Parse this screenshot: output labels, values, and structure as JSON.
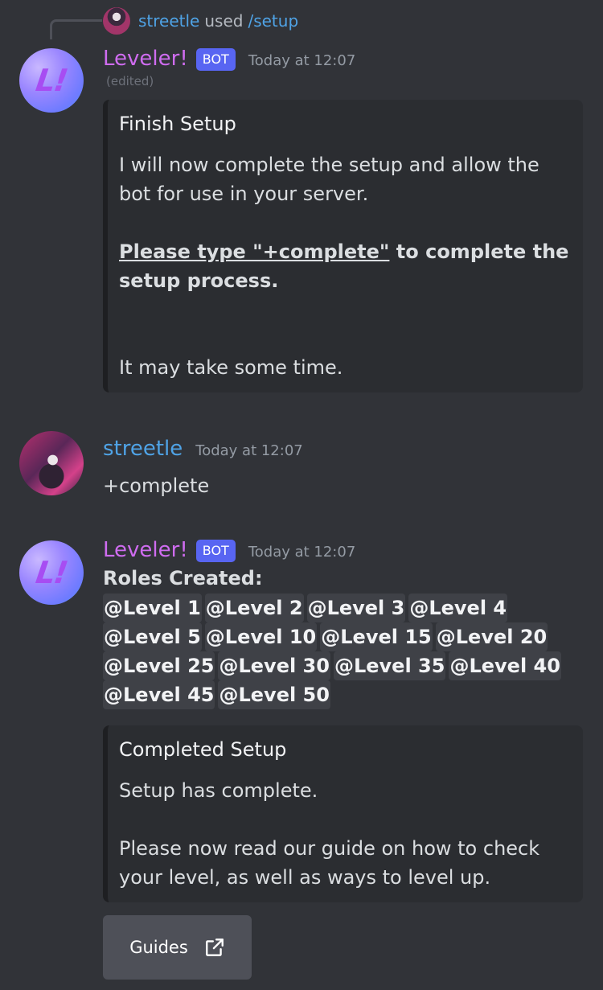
{
  "reply": {
    "username": "streetle",
    "used": "used",
    "command": "/setup"
  },
  "message1": {
    "author": "Leveler!",
    "bot_tag": "BOT",
    "timestamp": "Today at 12:07",
    "edited": "(edited)",
    "embed": {
      "title": "Finish Setup",
      "line1": "I will now complete the setup and allow the",
      "line2": "bot for use in your server.",
      "bold_underlined": "Please type \"+complete\"",
      "bold_rest": " to complete the",
      "bold_line2": "setup process.",
      "footer": "It may take some time."
    }
  },
  "message2": {
    "author": "streetle",
    "timestamp": "Today at 12:07",
    "text": "+complete"
  },
  "message3": {
    "author": "Leveler!",
    "bot_tag": "BOT",
    "timestamp": "Today at 12:07",
    "roles_title": "Roles Created:",
    "roles": [
      "@Level 1",
      "@Level 2",
      "@Level 3",
      "@Level 4",
      "@Level 5",
      "@Level 10",
      "@Level 15",
      "@Level 20",
      "@Level 25",
      "@Level 30",
      "@Level 35",
      "@Level 40",
      "@Level 45",
      "@Level 50"
    ],
    "embed": {
      "title": "Completed Setup",
      "line1": "Setup has complete.",
      "line2": "Please now read our guide on how to check",
      "line3": "your level, as well as ways to level up."
    },
    "button_label": "Guides"
  },
  "colors": {
    "background": "#313338",
    "bot_name": "#cf6cf0",
    "user_name": "#4fa3e6",
    "bot_tag": "#5865f2",
    "embed_bg": "#2b2d31",
    "button_bg": "#4e5058"
  },
  "icons": {
    "bot_avatar": "leveler-logo-avatar",
    "external_link": "external-link-icon"
  }
}
